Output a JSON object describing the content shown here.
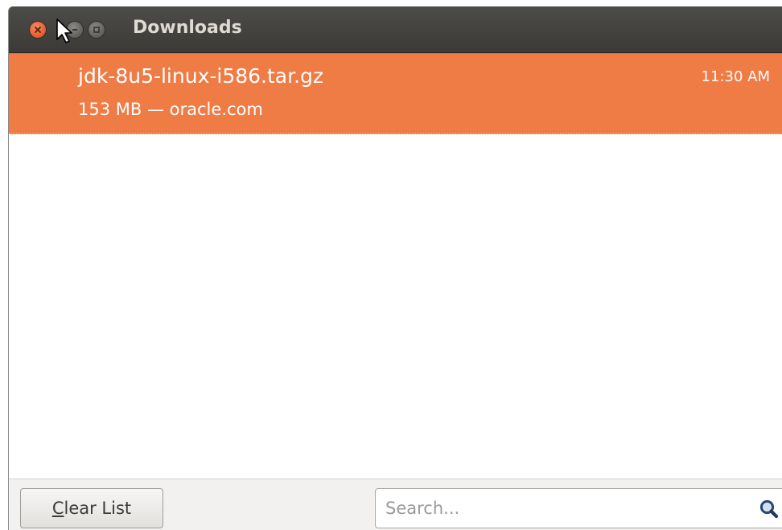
{
  "window": {
    "title": "Downloads"
  },
  "downloads": [
    {
      "filename": "jdk-8u5-linux-i586.tar.gz",
      "details": "153 MB — oracle.com",
      "time": "11:30 AM"
    }
  ],
  "footer": {
    "clear_label_mnemonic": "C",
    "clear_label_rest": "lear List",
    "search_placeholder": "Search..."
  },
  "colors": {
    "selected_row": "#ef7b45",
    "titlebar": "#3c3b37",
    "close_button": "#e25a2c"
  },
  "icons": [
    "close-icon",
    "minimize-icon",
    "maximize-icon",
    "mouse-cursor-icon",
    "search-icon"
  ]
}
